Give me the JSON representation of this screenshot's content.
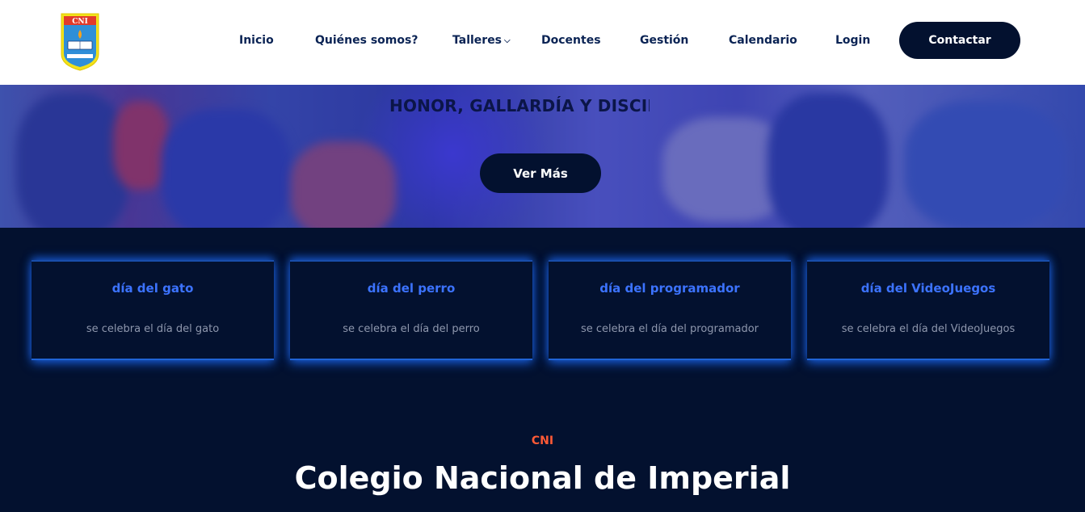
{
  "header": {
    "logo_text": "CNI",
    "nav": [
      {
        "label": "Inicio"
      },
      {
        "label": "Quiénes somos?"
      },
      {
        "label": "Talleres"
      },
      {
        "label": "Docentes"
      },
      {
        "label": "Gestión"
      },
      {
        "label": "Calendario"
      },
      {
        "label": "Login"
      }
    ],
    "contact_label": "Contactar"
  },
  "hero": {
    "title": "HONOR, GALLARDÍA Y DISCIP",
    "button_label": "Ver Más"
  },
  "cards": [
    {
      "title": "día del gato",
      "description": "se celebra el día del gato"
    },
    {
      "title": "día del perro",
      "description": "se celebra el día del perro"
    },
    {
      "title": "día del programador",
      "description": "se celebra el día del programador"
    },
    {
      "title": "día del VideoJuegos",
      "description": "se celebra el día del VideoJuegos"
    }
  ],
  "section": {
    "eyebrow": "CNI",
    "title": "Colegio Nacional de Imperial"
  },
  "colors": {
    "navy": "#03112f",
    "accent_blue": "#3c73ff",
    "eyebrow_orange": "#ff5a36"
  }
}
